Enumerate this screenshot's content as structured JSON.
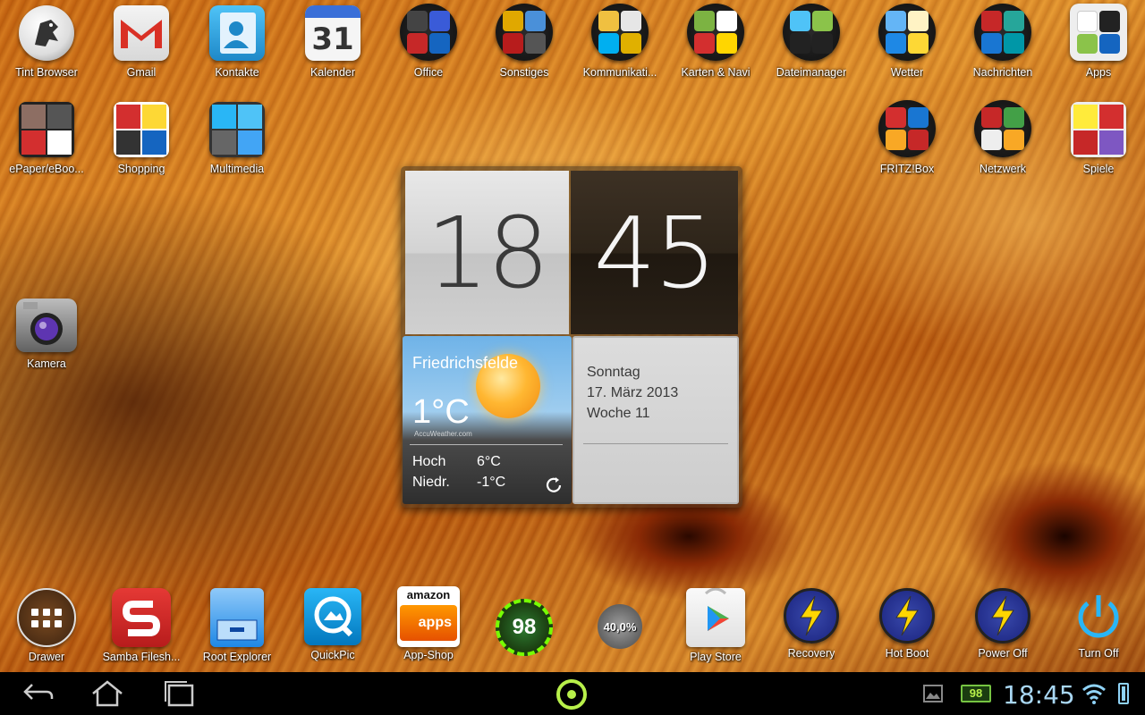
{
  "top_row_icons": [
    {
      "label": "Tint Browser",
      "icon": "tint-browser-icon"
    },
    {
      "label": "Gmail",
      "icon": "gmail-icon"
    },
    {
      "label": "Kontakte",
      "icon": "contacts-icon"
    },
    {
      "label": "Kalender",
      "icon": "calendar-icon",
      "badge": "31"
    },
    {
      "label": "Office",
      "icon": "office-folder-icon"
    },
    {
      "label": "Sonstiges",
      "icon": "misc-folder-icon"
    },
    {
      "label": "Kommunikati...",
      "icon": "communication-folder-icon"
    },
    {
      "label": "Karten & Navi",
      "icon": "maps-folder-icon"
    },
    {
      "label": "Dateimanager",
      "icon": "filemanager-folder-icon"
    },
    {
      "label": "Wetter",
      "icon": "weather-folder-icon"
    },
    {
      "label": "Nachrichten",
      "icon": "news-folder-icon"
    },
    {
      "label": "Apps",
      "icon": "apps-folder-icon"
    }
  ],
  "second_row_left_icons": [
    {
      "label": "ePaper/eBoo...",
      "icon": "epaper-folder-icon"
    },
    {
      "label": "Shopping",
      "icon": "shopping-folder-icon"
    },
    {
      "label": "Multimedia",
      "icon": "multimedia-folder-icon"
    }
  ],
  "second_row_right_icons": [
    {
      "label": "FRITZ!Box",
      "icon": "fritzbox-folder-icon"
    },
    {
      "label": "Netzwerk",
      "icon": "network-folder-icon"
    },
    {
      "label": "Spiele",
      "icon": "games-folder-icon"
    }
  ],
  "camera": {
    "label": "Kamera",
    "icon": "camera-icon"
  },
  "clock_widget": {
    "hour": "18",
    "minute": "45",
    "weather": {
      "city": "Friedrichsfelde",
      "temperature": "1°C",
      "provider": "AccuWeather.com",
      "high_label": "Hoch",
      "high_value": "6°C",
      "low_label": "Niedr.",
      "low_value": "-1°C"
    },
    "date": {
      "weekday": "Sonntag",
      "date": "17. März 2013",
      "week": "Woche 11"
    }
  },
  "dock_icons": [
    {
      "label": "Drawer",
      "icon": "app-drawer-icon"
    },
    {
      "label": "Samba Filesh...",
      "icon": "samba-icon"
    },
    {
      "label": "Root Explorer",
      "icon": "root-explorer-icon"
    },
    {
      "label": "QuickPic",
      "icon": "quickpic-icon"
    },
    {
      "label": "App-Shop",
      "icon": "amazon-appstore-icon",
      "sub1": "amazon",
      "sub2": "apps"
    },
    {
      "label": "",
      "icon": "battery-widget-icon",
      "value": "98"
    },
    {
      "label": "",
      "icon": "memory-widget-icon",
      "value": "40,0%"
    },
    {
      "label": "Play Store",
      "icon": "play-store-icon"
    },
    {
      "label": "Recovery",
      "icon": "recovery-icon"
    },
    {
      "label": "Hot Boot",
      "icon": "hot-boot-icon"
    },
    {
      "label": "Power Off",
      "icon": "power-off-icon"
    },
    {
      "label": "Turn Off",
      "icon": "turn-off-icon"
    }
  ],
  "status_bar": {
    "battery_badge": "98",
    "time": "18:45"
  },
  "colors": {
    "status_time": "#a9d7f3",
    "home_ring": "#b8f04a"
  }
}
